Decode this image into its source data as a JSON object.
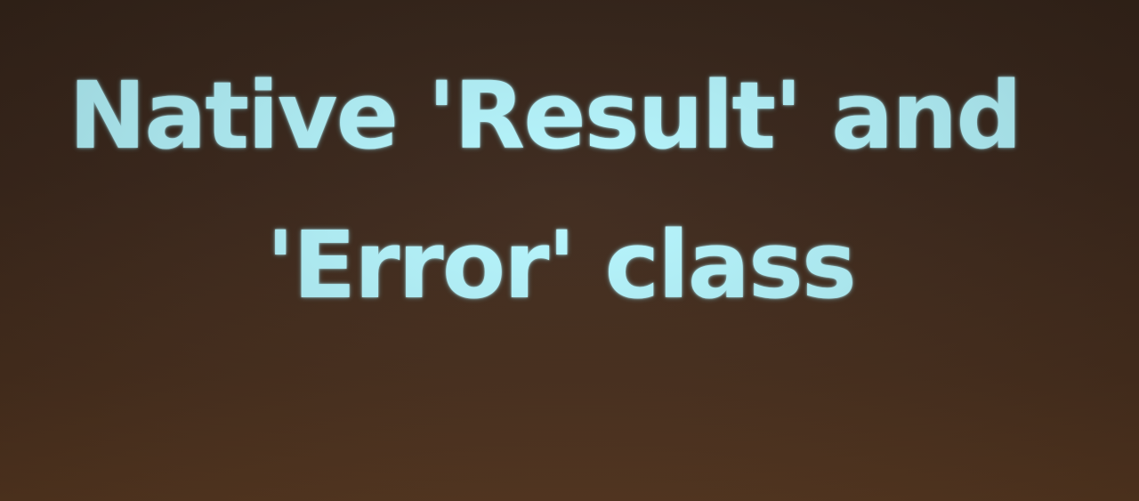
{
  "slide": {
    "title_line_1": "Native 'Result' and",
    "title_line_2": "'Error' class"
  },
  "colors": {
    "background": "#3b271b",
    "title_text": "#b6f7ff"
  }
}
